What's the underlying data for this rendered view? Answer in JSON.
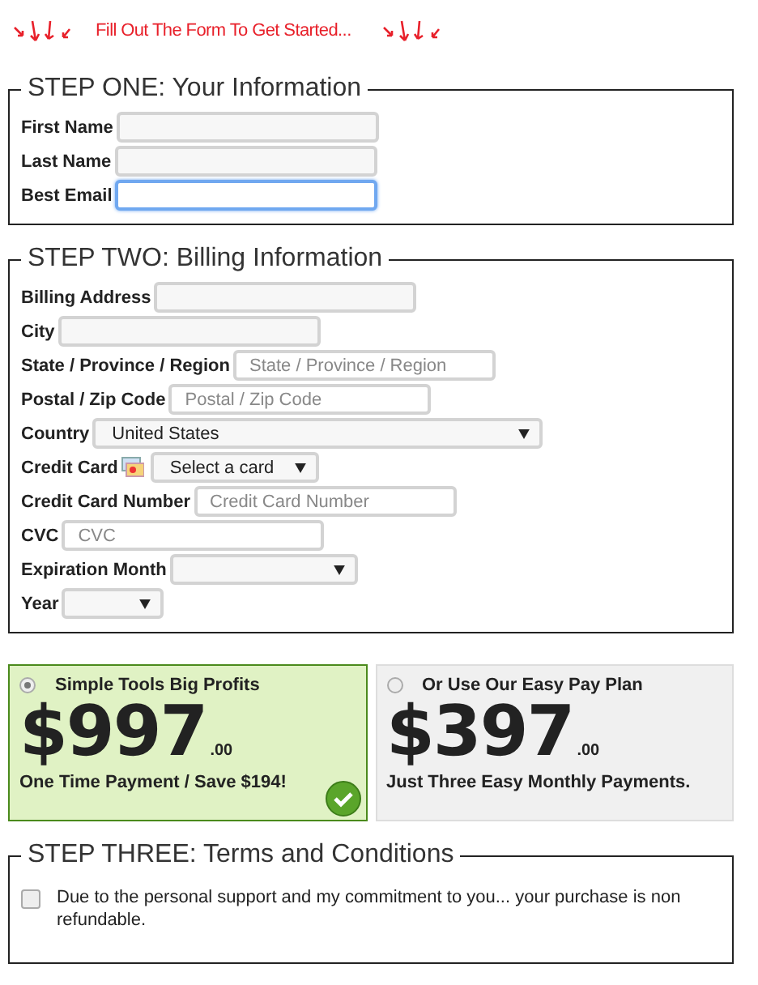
{
  "header": {
    "text": "Fill Out The Form To Get Started..."
  },
  "step_one": {
    "legend": "STEP ONE: Your Information",
    "fields": [
      {
        "label": "First Name",
        "kind": "text",
        "focused": false
      },
      {
        "label": "Last Name",
        "kind": "text",
        "focused": false
      },
      {
        "label": "Best Email",
        "kind": "text",
        "focused": true
      }
    ]
  },
  "step_two": {
    "legend": "STEP TWO: Billing Information",
    "fields": [
      {
        "label": "Billing Address",
        "kind": "text"
      },
      {
        "label": "City",
        "kind": "text"
      },
      {
        "label": "State / Province / Region",
        "kind": "text",
        "placeholder": "State / Province / Region"
      },
      {
        "label": "Postal / Zip Code",
        "kind": "text",
        "placeholder": "Postal / Zip Code"
      },
      {
        "label": "Country",
        "kind": "wide_select",
        "value": "United States"
      },
      {
        "label": "Credit Card",
        "kind": "card_select",
        "value": "Select a card"
      },
      {
        "label": "Credit Card Number",
        "kind": "text",
        "placeholder": "Credit Card Number"
      },
      {
        "label": "CVC",
        "kind": "text",
        "placeholder": "CVC"
      },
      {
        "label": "Expiration Month",
        "kind": "select"
      },
      {
        "label": "Year",
        "kind": "small_select"
      }
    ]
  },
  "plans": [
    {
      "title": "Simple Tools Big Profits",
      "price": "$997",
      "cents": ".00",
      "note": "One Time Payment / Save $194!",
      "selected": true
    },
    {
      "title": "Or Use Our Easy Pay Plan",
      "price": "$397",
      "cents": ".00",
      "note": "Just Three Easy Monthly Payments.",
      "selected": false
    }
  ],
  "step_three": {
    "legend": "STEP THREE: Terms and Conditions",
    "terms": {
      "text": "Due to the personal support and my commitment to you... your purchase is non refundable.",
      "checked": false
    }
  }
}
